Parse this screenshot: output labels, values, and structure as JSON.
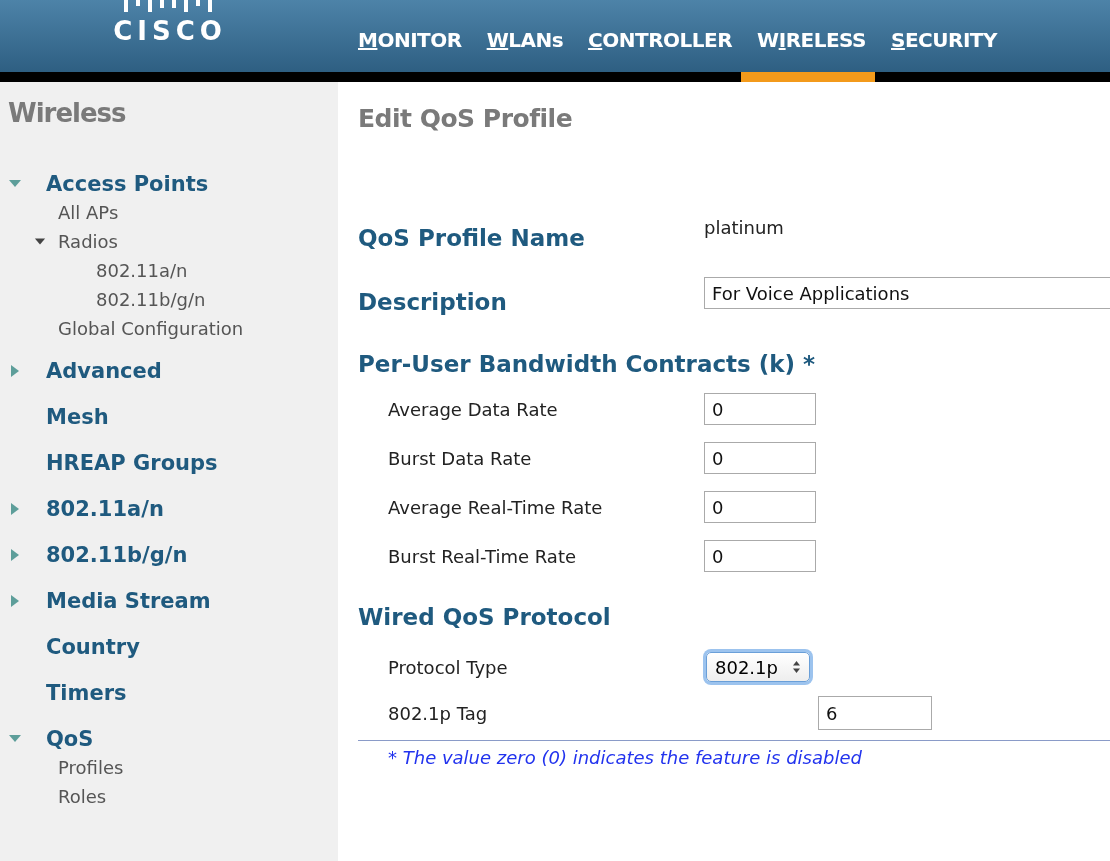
{
  "header": {
    "logo": "CISCO",
    "nav": [
      {
        "key": "M",
        "rest": "ONITOR",
        "selected": false
      },
      {
        "key": "W",
        "rest": "LANs",
        "selected": false
      },
      {
        "key": "C",
        "rest": "ONTROLLER",
        "selected": false
      },
      {
        "lead": "W",
        "key": "I",
        "rest": "RELESS",
        "selected": true
      },
      {
        "key": "S",
        "rest": "ECURITY",
        "selected": false
      }
    ]
  },
  "sidebar": {
    "title": "Wireless",
    "items": [
      {
        "label": "Access Points",
        "expanded": true,
        "children": [
          {
            "label": "All APs"
          },
          {
            "label": "Radios",
            "expanded": true,
            "children": [
              {
                "label": "802.11a/n"
              },
              {
                "label": "802.11b/g/n"
              }
            ]
          },
          {
            "label": "Global Configuration"
          }
        ]
      },
      {
        "label": "Advanced",
        "expanded": false
      },
      {
        "label": "Mesh"
      },
      {
        "label": "HREAP Groups"
      },
      {
        "label": "802.11a/n",
        "expanded": false
      },
      {
        "label": "802.11b/g/n",
        "expanded": false
      },
      {
        "label": "Media Stream",
        "expanded": false
      },
      {
        "label": "Country"
      },
      {
        "label": "Timers"
      },
      {
        "label": "QoS",
        "expanded": true,
        "children": [
          {
            "label": "Profiles"
          },
          {
            "label": "Roles"
          }
        ]
      }
    ]
  },
  "page": {
    "title": "Edit QoS Profile",
    "profile_name": {
      "label": "QoS Profile Name",
      "value": "platinum"
    },
    "description": {
      "label": "Description",
      "value": "For Voice Applications"
    },
    "bandwidth": {
      "heading": "Per-User Bandwidth Contracts (k) *",
      "fields": [
        {
          "label": "Average Data Rate",
          "value": "0"
        },
        {
          "label": "Burst Data Rate",
          "value": "0"
        },
        {
          "label": "Average Real-Time Rate",
          "value": "0"
        },
        {
          "label": "Burst Real-Time Rate",
          "value": "0"
        }
      ]
    },
    "wired": {
      "heading": "Wired QoS Protocol",
      "protocol_type": {
        "label": "Protocol Type",
        "value": "802.1p",
        "focused": true
      },
      "tag": {
        "label": "802.1p Tag",
        "value": "6"
      }
    },
    "footnote": "* The value zero (0) indicates the feature is disabled"
  }
}
